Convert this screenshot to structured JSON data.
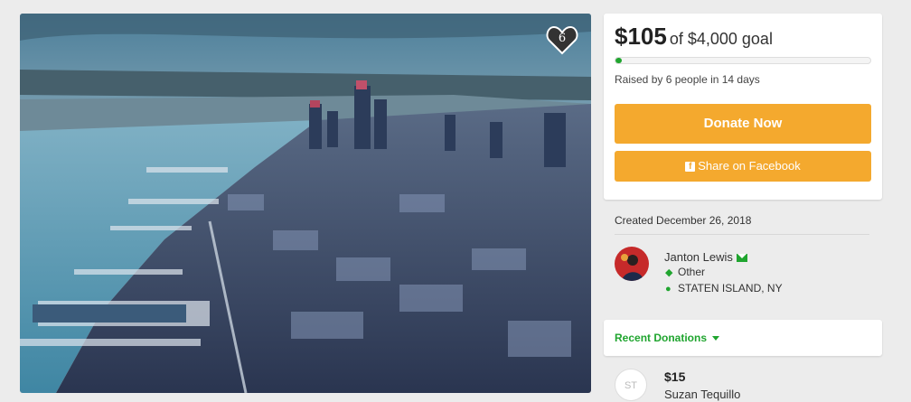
{
  "campaign": {
    "heart_count": "6"
  },
  "progress": {
    "raised_amount": "$105",
    "goal_text": "of $4,000 goal",
    "fraction": 0.026,
    "raised_by_text": "Raised by 6 people in 14 days"
  },
  "buttons": {
    "donate_label": "Donate Now",
    "share_label": "Share on Facebook"
  },
  "created_text": "Created December 26, 2018",
  "organizer": {
    "name": "Janton Lewis",
    "category": "Other",
    "location": "STATEN ISLAND, NY"
  },
  "recent_donations": {
    "label": "Recent Donations",
    "items": [
      {
        "initials": "ST",
        "amount": "$15",
        "name": "Suzan Tequillo"
      }
    ]
  },
  "colors": {
    "accent_green": "#20a52f",
    "button_orange": "#f4a92e"
  },
  "icons": [
    "heart-icon",
    "facebook-icon",
    "verified-mail-icon",
    "tag-icon",
    "location-pin-icon",
    "chevron-down-icon"
  ]
}
